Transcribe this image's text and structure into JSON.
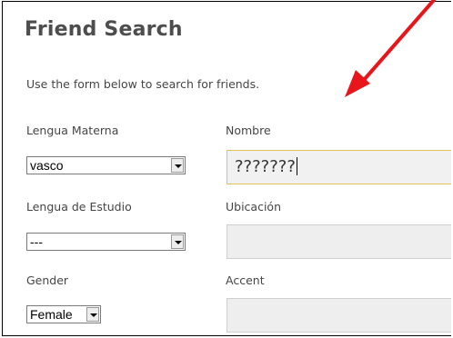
{
  "page": {
    "title": "Friend Search",
    "intro": "Use the form below to search for friends."
  },
  "form": {
    "native_language": {
      "label": "Lengua Materna",
      "value": "vasco"
    },
    "study_language": {
      "label": "Lengua de Estudio",
      "value": "---"
    },
    "gender": {
      "label": "Gender",
      "value": "Female"
    },
    "name": {
      "label": "Nombre",
      "value": "???????"
    },
    "location": {
      "label": "Ubicación",
      "value": ""
    },
    "accent": {
      "label": "Accent",
      "value": ""
    }
  },
  "colors": {
    "annotation_arrow": "#e8151b",
    "focus_border": "#e2c25e",
    "text": "#454545"
  }
}
